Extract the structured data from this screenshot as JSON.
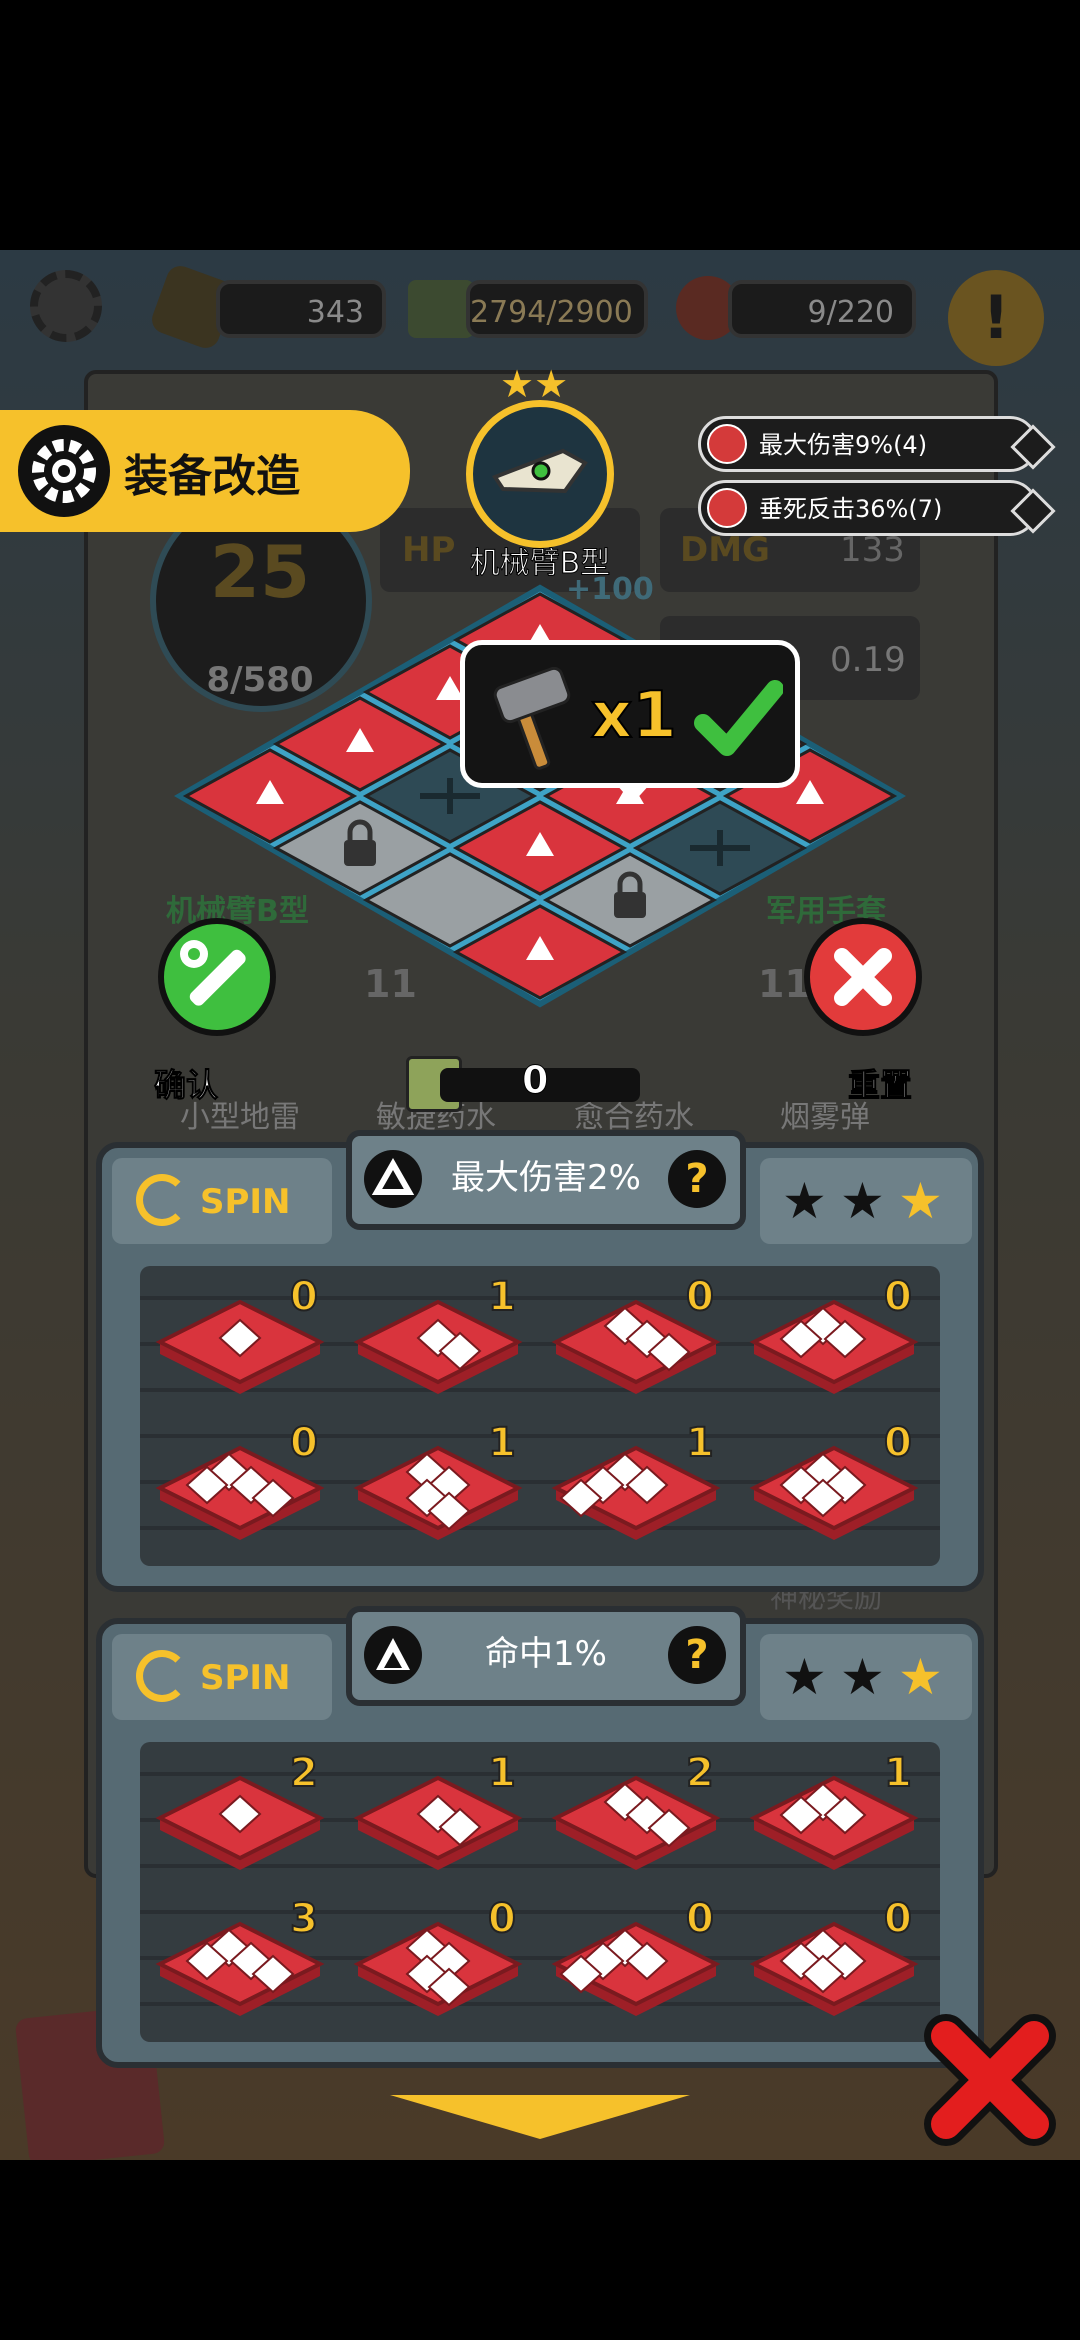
{
  "top_bar": {
    "settings_icon": "gear-icon",
    "gold": "343",
    "energy": "2794/2900",
    "food": "9/220",
    "alert_icon": "exclamation-icon"
  },
  "modify_banner": {
    "title": "装备改造",
    "icon": "gear-icon"
  },
  "equipment": {
    "name": "机械臂B型",
    "stars": 2,
    "level": "25",
    "exp": "8/580",
    "bonus": "+100",
    "dmg": "133",
    "stat_value": "0.19"
  },
  "stat_labels": {
    "hp": "HP",
    "dmg": "DMG"
  },
  "buffs": [
    {
      "text": "最大伤害9%(4)",
      "icon": "triangle-up-icon"
    },
    {
      "text": "垂死反击36%(7)",
      "icon": "cone-icon"
    }
  ],
  "craft_popup": {
    "count": "x1",
    "icon": "hammer-icon",
    "check_icon": "checkmark-icon"
  },
  "bg_items": {
    "left_name": "机械臂B型",
    "right_name": "军用手套",
    "level_left": "11",
    "level_right": "11",
    "items": [
      "小型地雷",
      "敏捷药水",
      "愈合药水",
      "烟雾弹"
    ],
    "mystery_label": "神秘奖励"
  },
  "actions": {
    "confirm": "确认",
    "reset": "重置",
    "cube_count": "0"
  },
  "panels": [
    {
      "spin": "SPIN",
      "stat": "最大伤害2%",
      "stars_filled": 2,
      "star_colors": [
        "#111111",
        "#111111",
        "#f6c12b"
      ],
      "shapes": [
        {
          "count": "0"
        },
        {
          "count": "1"
        },
        {
          "count": "0"
        },
        {
          "count": "0"
        },
        {
          "count": "0"
        },
        {
          "count": "1"
        },
        {
          "count": "1"
        },
        {
          "count": "0"
        }
      ]
    },
    {
      "spin": "SPIN",
      "stat": "命中1%",
      "stars_filled": 2,
      "star_colors": [
        "#111111",
        "#111111",
        "#f6c12b"
      ],
      "shapes": [
        {
          "count": "2"
        },
        {
          "count": "1"
        },
        {
          "count": "2"
        },
        {
          "count": "1"
        },
        {
          "count": "3"
        },
        {
          "count": "0"
        },
        {
          "count": "0"
        },
        {
          "count": "0"
        }
      ]
    }
  ],
  "colors": {
    "accent": "#f6c12b",
    "tile_red": "#d9343d",
    "panel": "#566a73",
    "confirm_green": "#3fbf3f",
    "reset_red": "#e23b3b"
  }
}
